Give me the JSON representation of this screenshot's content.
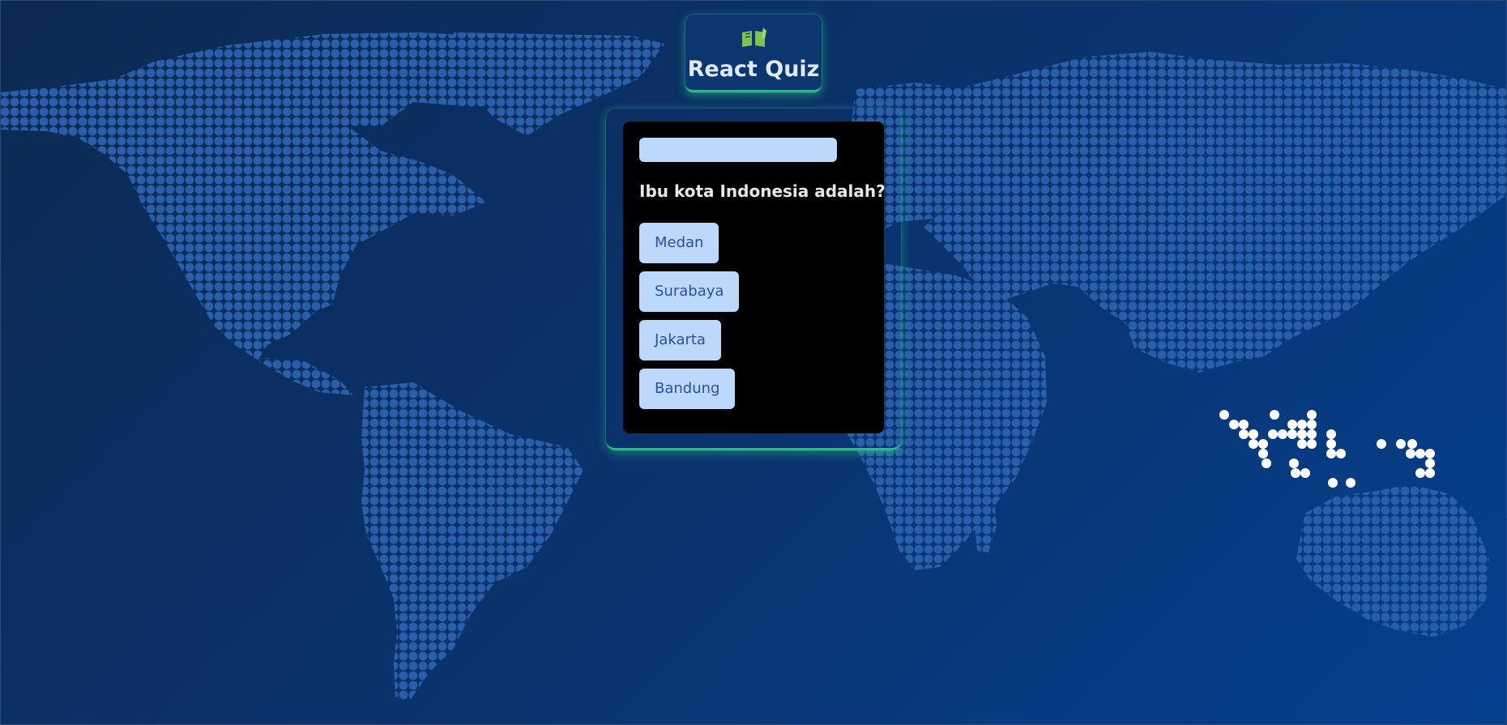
{
  "app": {
    "title": "React Quiz",
    "logo_icon": "open-book-icon"
  },
  "quiz": {
    "progress_fraction": 1.0,
    "question": "Ibu kota Indonesia adalah?",
    "options": [
      {
        "label": "Medan"
      },
      {
        "label": "Surabaya"
      },
      {
        "label": "Jakarta"
      },
      {
        "label": "Bandung"
      }
    ]
  },
  "background": {
    "image": "dotted-world-map",
    "highlighted_region": "Indonesia"
  },
  "colors": {
    "page_gradient_start": "#0c2a52",
    "page_gradient_end": "#05408f",
    "map_dots": "#2a5ea8",
    "map_highlight": "#ffffff",
    "accent_glow": "#27c07a",
    "card_background": "#000000",
    "button_background": "#bcd8fb",
    "button_text": "#2b4fa6",
    "header_text": "#dfe9f7",
    "book_icon": "#7fc453"
  }
}
